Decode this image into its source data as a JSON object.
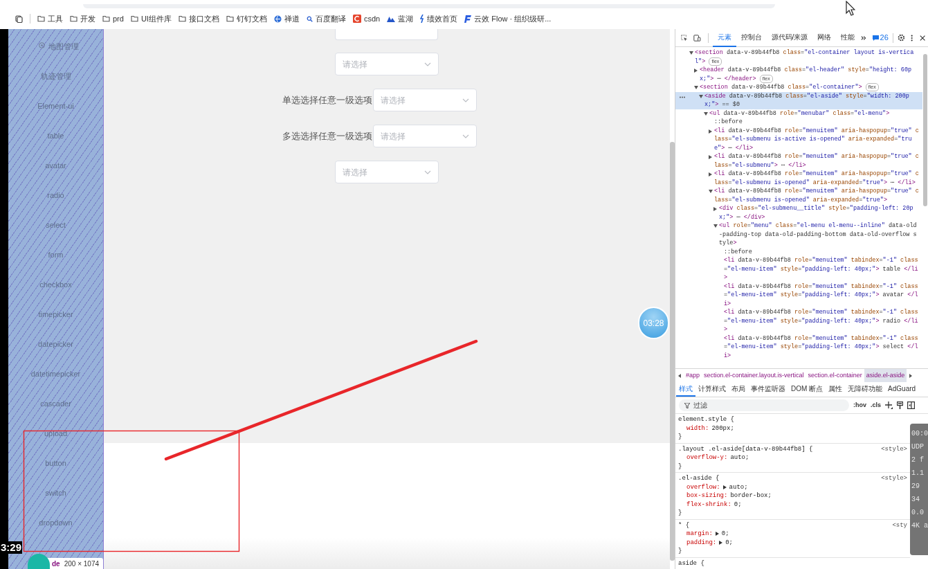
{
  "bookmarks": [
    {
      "kind": "folder",
      "label": "工具"
    },
    {
      "kind": "folder",
      "label": "开发"
    },
    {
      "kind": "folder",
      "label": "prd"
    },
    {
      "kind": "folder",
      "label": "UI组件库"
    },
    {
      "kind": "folder",
      "label": "接口文档"
    },
    {
      "kind": "folder",
      "label": "钉钉文档"
    },
    {
      "kind": "globe",
      "label": "禅道"
    },
    {
      "kind": "search",
      "label": "百度翻译"
    },
    {
      "kind": "tile",
      "label": "csdn"
    },
    {
      "kind": "wave",
      "label": "蓝湖"
    },
    {
      "kind": "pin",
      "label": "绩效首页"
    },
    {
      "kind": "flag",
      "label": "云效 Flow · 组织级研..."
    }
  ],
  "sidebar": {
    "items": [
      {
        "kind": "with-icon",
        "label": "地图管理"
      },
      {
        "kind": "plain",
        "label": "轨迹管理"
      },
      {
        "kind": "plain",
        "label": "Element-ui"
      },
      {
        "kind": "plain",
        "label": "table"
      },
      {
        "kind": "plain",
        "label": "avatar"
      },
      {
        "kind": "plain",
        "label": "radio"
      },
      {
        "kind": "plain",
        "label": "select"
      },
      {
        "kind": "plain",
        "label": "form"
      },
      {
        "kind": "plain",
        "label": "checkbox"
      },
      {
        "kind": "plain",
        "label": "timepicker"
      },
      {
        "kind": "plain",
        "label": "datepicker"
      },
      {
        "kind": "plain",
        "label": "datetimepicker"
      },
      {
        "kind": "plain",
        "label": "cascader"
      },
      {
        "kind": "plain",
        "label": "upload"
      },
      {
        "kind": "plain",
        "label": "button"
      },
      {
        "kind": "plain",
        "label": "switch"
      },
      {
        "kind": "plain",
        "label": "dropdown"
      }
    ]
  },
  "form": {
    "rows": [
      {
        "kind": "cut-off"
      },
      {
        "kind": "select",
        "placeholder": "请选择"
      },
      {
        "kind": "select",
        "label": "单选选择任意一级选项",
        "placeholder": "请选择"
      },
      {
        "kind": "select",
        "label": "多选选择任意一级选项",
        "placeholder": "请选择"
      },
      {
        "kind": "select",
        "placeholder": "请选择"
      }
    ]
  },
  "devtools": {
    "tabs": [
      {
        "label": "元素",
        "selected": true
      },
      {
        "label": "控制台",
        "selected": false
      },
      {
        "label": "源代码/来源",
        "selected": false
      },
      {
        "label": "网络",
        "selected": false
      },
      {
        "label": "性能",
        "selected": false
      }
    ],
    "issues_count": "26",
    "tree": [
      {
        "text": "<section data-v-89b44fb8 class=\"el-container layout is-vertical\">",
        "expanded": true,
        "selected": false,
        "badge": "flex",
        "children": [
          {
            "text": "<header data-v-89b44fb8 class=\"el-header\" style=\"height: 60px;\"> ⋯ </header>",
            "expanded": false,
            "selected": false,
            "badge": "flex"
          },
          {
            "text": "<section data-v-89b44fb8 class=\"el-container\">",
            "expanded": true,
            "selected": false,
            "badge": "flex",
            "children": [
              {
                "text": "<aside data-v-89b44fb8 class=\"el-aside\" style=\"width: 200px;\"> == $0",
                "expanded": true,
                "selected": true,
                "children": [
                  {
                    "text": "<ul data-v-89b44fb8 role=\"menubar\" class=\"el-menu\">",
                    "expanded": true,
                    "selected": false,
                    "children": [
                      {
                        "text": "::before",
                        "selected": false
                      },
                      {
                        "text": "<li data-v-89b44fb8 role=\"menuitem\" aria-haspopup=\"true\" class=\"el-submenu is-active is-opened\" aria-expanded=\"true\"> ⋯ </li>",
                        "expanded": false,
                        "selected": false
                      },
                      {
                        "text": "<li data-v-89b44fb8 role=\"menuitem\" aria-haspopup=\"true\" class=\"el-submenu\"> ⋯ </li>",
                        "expanded": false,
                        "selected": false
                      },
                      {
                        "text": "<li data-v-89b44fb8 role=\"menuitem\" aria-haspopup=\"true\" class=\"el-submenu is-opened\" aria-expanded=\"true\"> ⋯ </li>",
                        "expanded": false,
                        "selected": false
                      },
                      {
                        "text": "<li data-v-89b44fb8 role=\"menuitem\" aria-haspopup=\"true\" class=\"el-submenu is-opened\" aria-expanded=\"true\">",
                        "expanded": true,
                        "selected": false,
                        "children": [
                          {
                            "text": "<div class=\"el-submenu__title\" style=\"padding-left: 20px;\"> ⋯ </div>",
                            "expanded": false,
                            "selected": false
                          },
                          {
                            "text": "<ul role=\"menu\" class=\"el-menu el-menu--inline\" data-old-padding-top data-old-padding-bottom data-old-overflow style>",
                            "expanded": true,
                            "selected": false,
                            "children": [
                              {
                                "text": "::before",
                                "selected": false
                              },
                              {
                                "text": "<li data-v-89b44fb8 role=\"menuitem\" tabindex=\"-1\" class=\"el-menu-item\" style=\"padding-left: 40px;\"> table </li>",
                                "selected": false
                              },
                              {
                                "text": "<li data-v-89b44fb8 role=\"menuitem\" tabindex=\"-1\" class=\"el-menu-item\" style=\"padding-left: 40px;\"> avatar </li>",
                                "selected": false
                              },
                              {
                                "text": "<li data-v-89b44fb8 role=\"menuitem\" tabindex=\"-1\" class=\"el-menu-item\" style=\"padding-left: 40px;\"> radio </li>",
                                "selected": false
                              },
                              {
                                "text": "<li data-v-89b44fb8 role=\"menuitem\" tabindex=\"-1\" class=\"el-menu-item\" style=\"padding-left: 40px;\"> select </li>",
                                "selected": false
                              }
                            ]
                          }
                        ]
                      }
                    ]
                  }
                ]
              }
            ]
          }
        ]
      }
    ],
    "breadcrumbs": [
      {
        "label": "#app",
        "selected": false
      },
      {
        "label": "section.el-container.layout.is-vertical",
        "selected": false
      },
      {
        "label": "section.el-container",
        "selected": false
      },
      {
        "label": "aside.el-aside",
        "selected": true
      }
    ],
    "pane_tabs": [
      {
        "label": "样式",
        "selected": true
      },
      {
        "label": "计算样式",
        "selected": false
      },
      {
        "label": "布局",
        "selected": false
      },
      {
        "label": "事件监听器",
        "selected": false
      },
      {
        "label": "DOM 断点",
        "selected": false
      },
      {
        "label": "属性",
        "selected": false
      },
      {
        "label": "无障碍功能",
        "selected": false
      },
      {
        "label": "AdGuard",
        "selected": false
      }
    ],
    "filter": {
      "placeholder": "过滤"
    },
    "filter_buttons": [
      ":hov",
      ".cls"
    ],
    "rules": [
      {
        "selector": "element.style {",
        "props": [
          {
            "name": "width:",
            "value": "200px;",
            "expandable": false
          }
        ],
        "close": "}"
      },
      {
        "selector": ".layout .el-aside[data-v-89b44fb8] {",
        "source": "<style>",
        "props": [
          {
            "name": "overflow-y:",
            "value": "auto;",
            "expandable": false
          }
        ],
        "close": "}"
      },
      {
        "selector": ".el-aside {",
        "source": "<style>",
        "props": [
          {
            "name": "overflow:",
            "value": "auto;",
            "expandable": true
          },
          {
            "name": "box-sizing:",
            "value": "border-box;",
            "expandable": false
          },
          {
            "name": "flex-shrink:",
            "value": "0;",
            "expandable": false
          }
        ],
        "close": "}"
      },
      {
        "selector": "* {",
        "source": "<sty",
        "props": [
          {
            "name": "margin:",
            "value": "0;",
            "expandable": true
          },
          {
            "name": "padding:",
            "value": "0;",
            "expandable": true
          }
        ],
        "close": "}"
      },
      {
        "selector": "aside {"
      }
    ]
  },
  "video_overlay": {
    "timer_bubble": "03:28",
    "timestamp": "3:29",
    "stats": [
      "00:0",
      "UDP",
      "2 f",
      "1.1",
      "29",
      "34",
      "0.0",
      "4K a"
    ]
  },
  "element_tooltip": {
    "tag": "de",
    "size": "200 × 1074"
  }
}
